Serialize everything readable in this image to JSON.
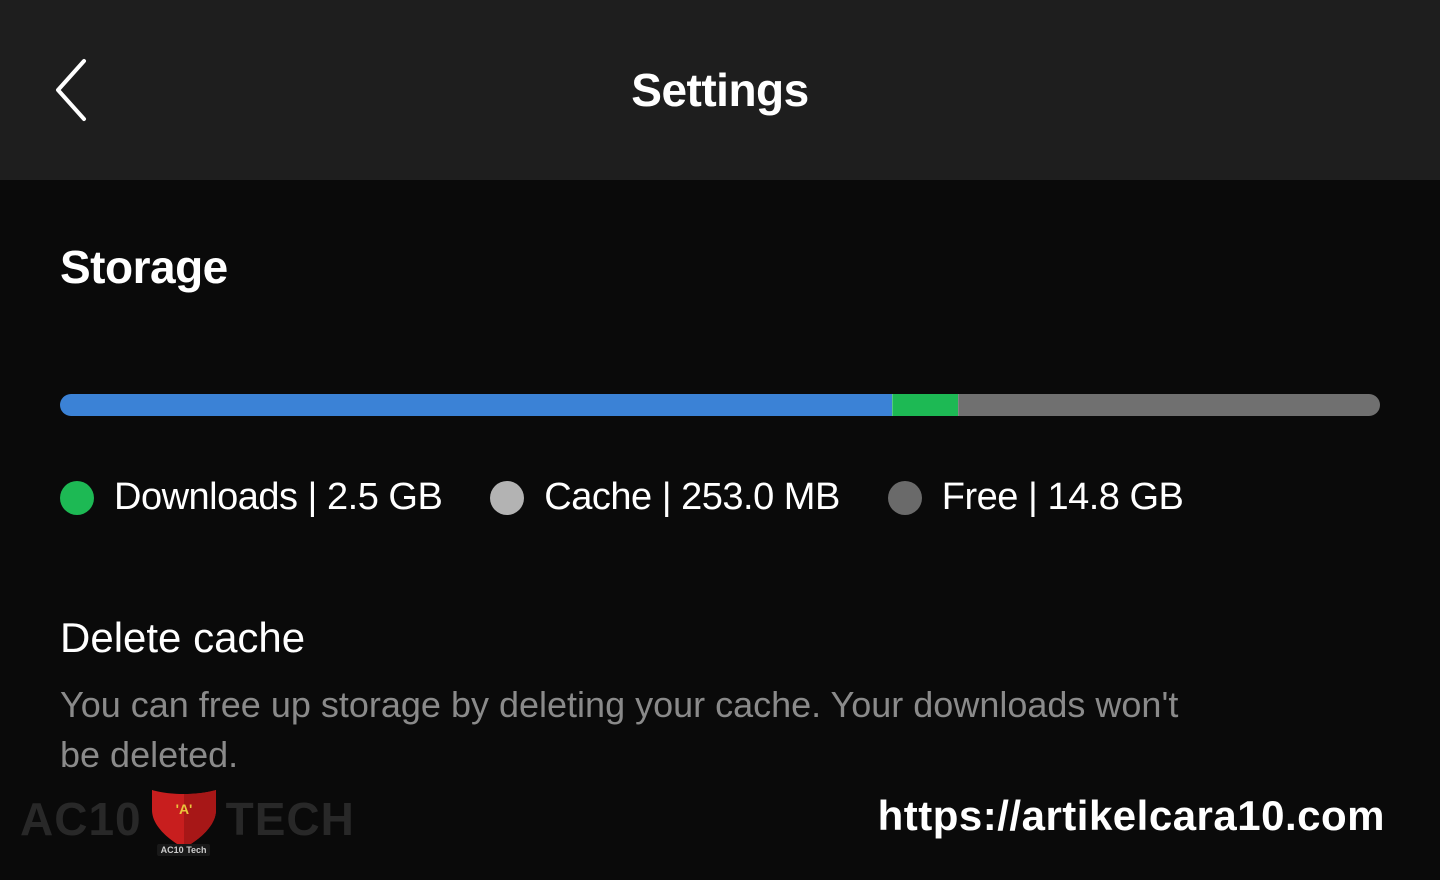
{
  "header": {
    "title": "Settings"
  },
  "storage": {
    "section_title": "Storage",
    "legend": {
      "downloads": {
        "label": "Downloads",
        "value": "2.5 GB"
      },
      "cache": {
        "label": "Cache",
        "value": "253.0 MB"
      },
      "free": {
        "label": "Free",
        "value": "14.8 GB"
      }
    },
    "delete_cache": {
      "title": "Delete cache",
      "description": "You can free up storage by deleting your cache. Your downloads won't be deleted."
    }
  },
  "watermark": {
    "left_prefix": "AC10",
    "left_suffix": "TECH",
    "shield_letter": "'A'",
    "shield_sub": "AC10 Tech",
    "right": "https://artikelcara10.com"
  },
  "colors": {
    "downloads_bar": "#3b82d6",
    "cache_bar": "#1db954",
    "free_bar": "#707070"
  }
}
